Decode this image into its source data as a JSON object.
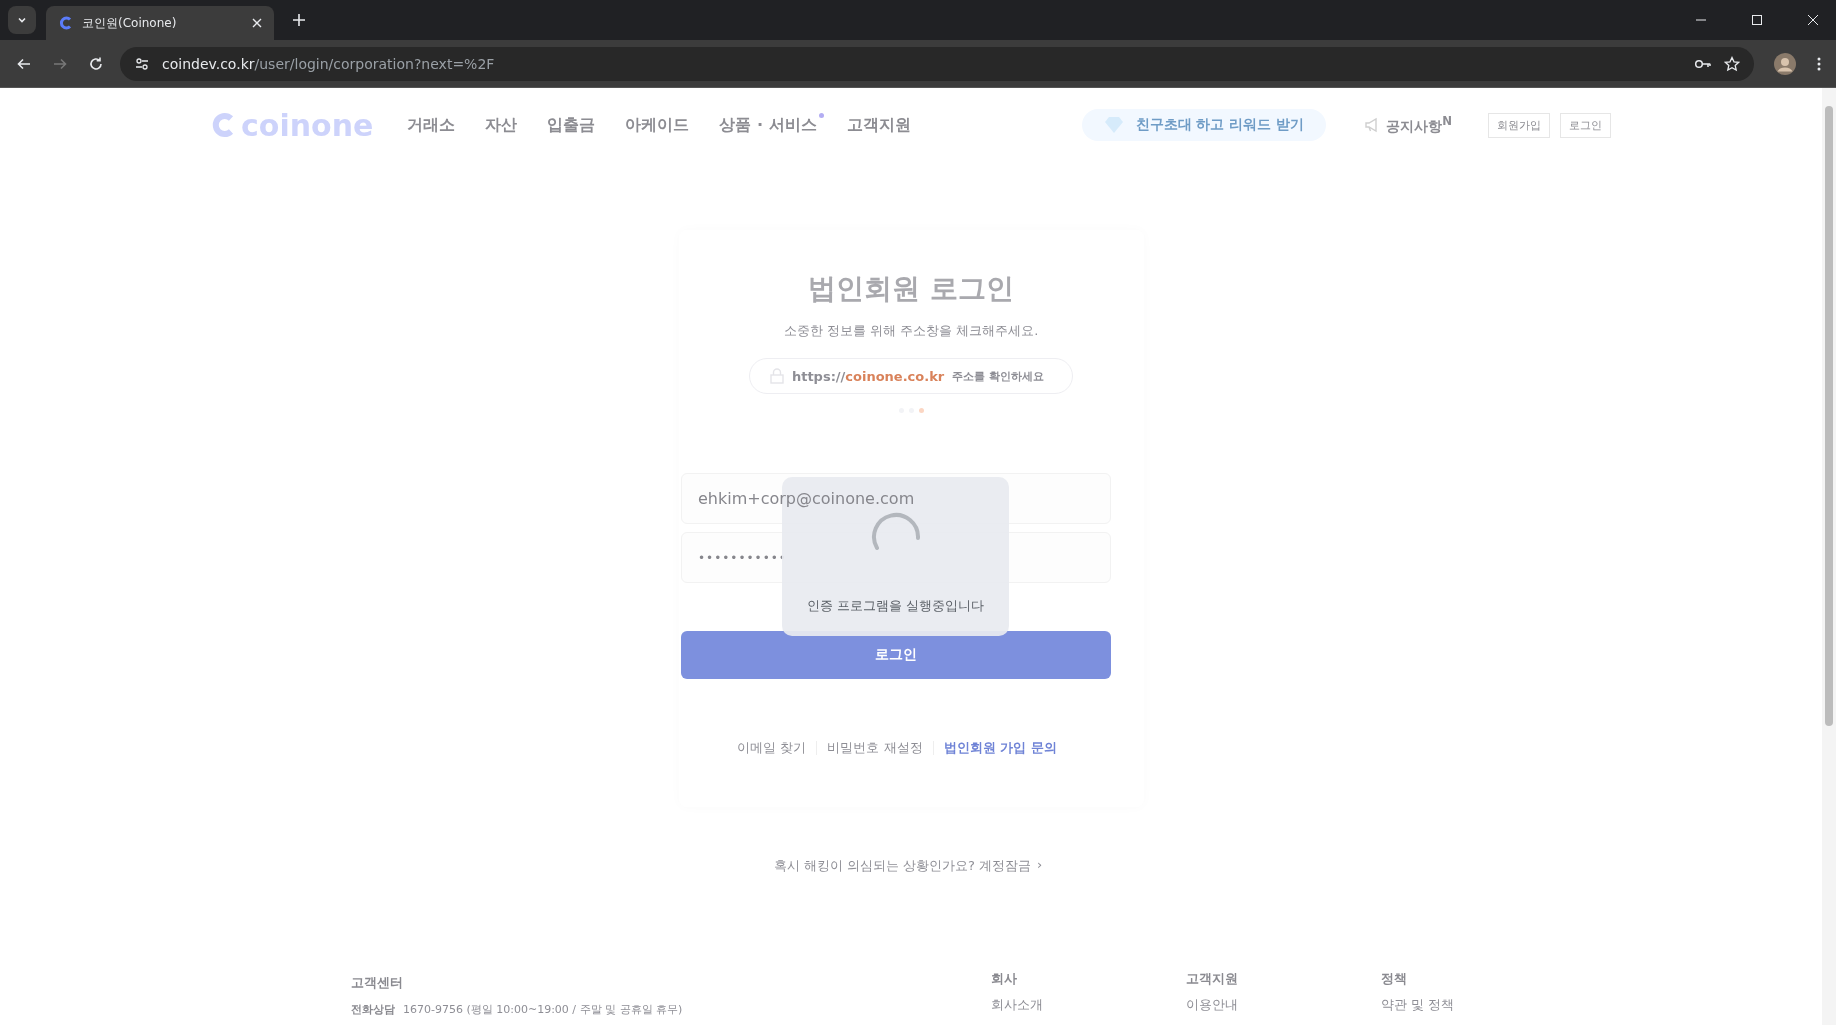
{
  "browser": {
    "tab": {
      "title": "코인원(Coinone)"
    },
    "url": {
      "host": "coindev.co.kr",
      "path": "/user/login/corporation?next=%2F"
    },
    "back_disabled": false,
    "forward_disabled": true
  },
  "header": {
    "logo": "coinone",
    "nav": [
      {
        "label": "거래소",
        "badge": false
      },
      {
        "label": "자산",
        "badge": false
      },
      {
        "label": "입출금",
        "badge": false
      },
      {
        "label": "아케이드",
        "badge": false
      },
      {
        "label": "상품 · 서비스",
        "badge": true
      },
      {
        "label": "고객지원",
        "badge": false
      }
    ],
    "promo": "친구초대 하고 리워드 받기",
    "notice": "공지사항$^{N}$",
    "buttons": [
      "회원가입",
      "로그인"
    ]
  },
  "login": {
    "title": "법인회원 로그인",
    "subtitle": "소중한 정보를 위해 주소창을 체크해주세요.",
    "url_check": {
      "scheme": "https://",
      "domain": "coinone.co.kr",
      "hint": "주소를 확인하세요"
    },
    "slides": [
      {
        "selected": false
      },
      {
        "selected": false
      },
      {
        "selected": true
      }
    ],
    "email": {
      "value": "ehkim+corp@coinone.com"
    },
    "password": {
      "value": "•••••••••••"
    },
    "submit": "로그인",
    "links": [
      {
        "label": "이메일 찾기",
        "highlight": false
      },
      {
        "label": "비밀번호 재설정",
        "highlight": false
      },
      {
        "label": "법인회원 가입 문의",
        "highlight": true
      }
    ]
  },
  "loading": {
    "message": "인증 프로그램을 실행중입니다"
  },
  "hack_notice": {
    "text": "혹시 해킹이 의심되는 상황인가요? 계정잠금",
    "arrow": "›"
  },
  "footer": {
    "support": {
      "title": "고객센터",
      "phone_label": "전화상담",
      "phone": "1670-9756 (평일 10:00~19:00 / 주말 및 공휴일 휴무)"
    },
    "columns": [
      {
        "title": "회사",
        "item": "회사소개"
      },
      {
        "title": "고객지원",
        "item": "이용안내"
      },
      {
        "title": "정책",
        "item": "약관 및 정책"
      }
    ]
  }
}
